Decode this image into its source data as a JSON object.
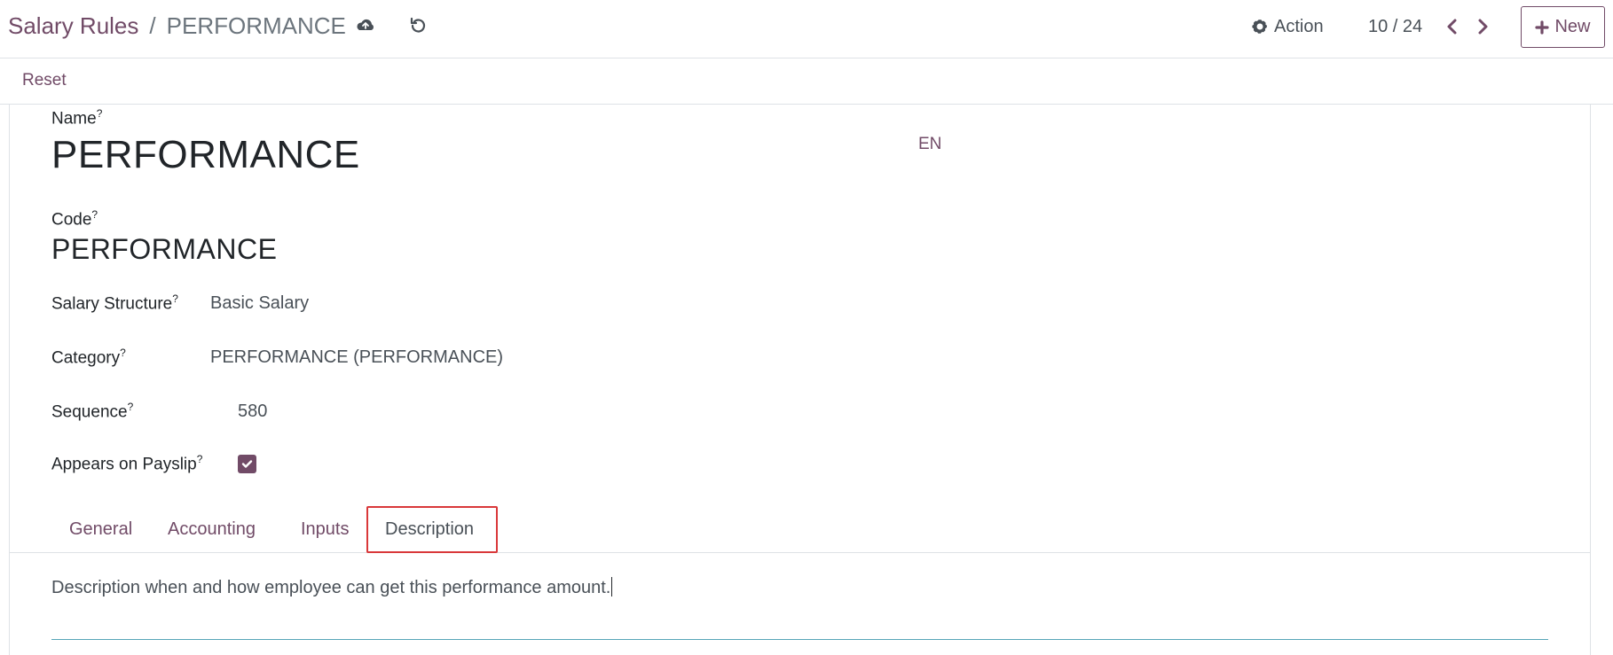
{
  "header": {
    "breadcrumb_parent": "Salary Rules",
    "breadcrumb_separator": "/",
    "breadcrumb_current": "PERFORMANCE",
    "action_label": "Action",
    "pager": "10 / 24",
    "new_label": "New"
  },
  "controls": {
    "reset_label": "Reset"
  },
  "form": {
    "name_label": "Name",
    "name_value": "PERFORMANCE",
    "language_code": "EN",
    "code_label": "Code",
    "code_value": "PERFORMANCE",
    "structure_label": "Salary Structure",
    "structure_value": "Basic Salary",
    "category_label": "Category",
    "category_value": "PERFORMANCE (PERFORMANCE)",
    "sequence_label": "Sequence",
    "sequence_value": "580",
    "payslip_label": "Appears on Payslip",
    "payslip_checked": true,
    "help_mark": "?"
  },
  "tabs": [
    {
      "label": "General"
    },
    {
      "label": "Accounting"
    },
    {
      "label": "Inputs"
    },
    {
      "label": "Description",
      "active": true
    }
  ],
  "description": {
    "text": "Description when and how employee can get this performance amount."
  },
  "colors": {
    "brand": "#714b67",
    "highlight": "#d9383a",
    "underline": "#56a5b8"
  }
}
